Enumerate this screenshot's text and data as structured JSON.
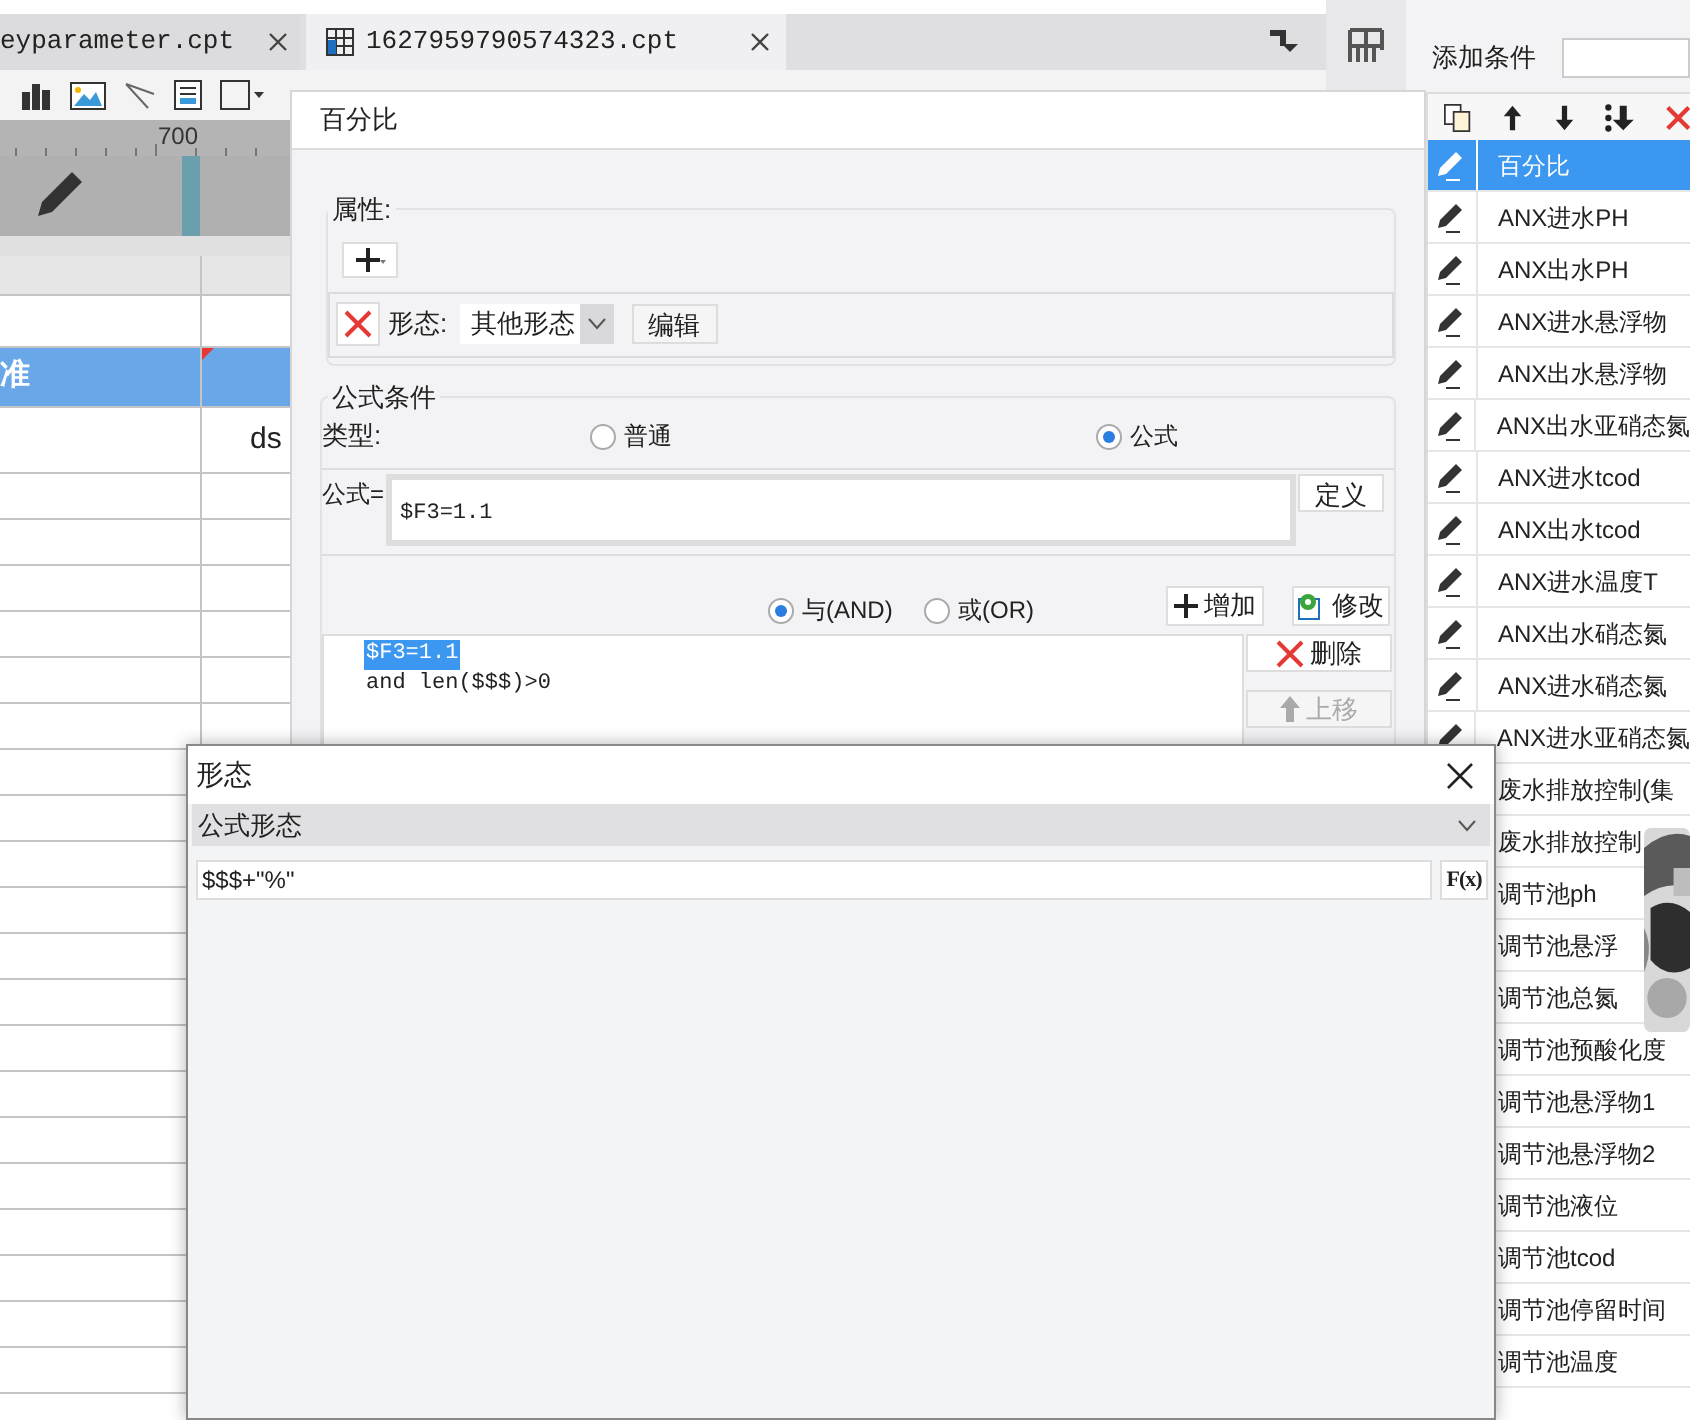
{
  "editor": {
    "tabs": [
      {
        "label": "eyparameter.cpt",
        "selected": false
      },
      {
        "label": "1627959790574323.cpt",
        "selected": true
      }
    ],
    "ruler_label": "700",
    "selected_row_text": "准",
    "cell_text": "ds"
  },
  "condition_dialog": {
    "title": "百分比",
    "attributes_legend": "属性:",
    "attribute": {
      "label": "形态:",
      "value": "其他形态",
      "edit_button": "编辑"
    },
    "formula_legend": "公式条件",
    "type_label": "类型:",
    "type_options": [
      {
        "label": "普通",
        "selected": false
      },
      {
        "label": "公式",
        "selected": true
      }
    ],
    "formula_label": "公式=",
    "formula": "$F3=1.1",
    "define_button": "定义",
    "joins": [
      {
        "label": "与(AND)",
        "selected": true
      },
      {
        "label": "或(OR)",
        "selected": false
      }
    ],
    "add_button": "增加",
    "modify_button": "修改",
    "conditions": [
      {
        "text": "$F3=1.1",
        "selected": true
      },
      {
        "text": "and len($$$)>0",
        "selected": false
      }
    ],
    "delete_button": "删除",
    "up_button": {
      "label": "上移",
      "disabled": true
    }
  },
  "conditions_panel": {
    "add_label": "添加条件",
    "items": [
      {
        "label": "百分比",
        "selected": true
      },
      {
        "label": "ANX进水PH",
        "selected": false
      },
      {
        "label": "ANX出水PH",
        "selected": false
      },
      {
        "label": "ANX进水悬浮物",
        "selected": false
      },
      {
        "label": "ANX出水悬浮物",
        "selected": false
      },
      {
        "label": "ANX出水亚硝态氮",
        "selected": false
      },
      {
        "label": "ANX进水tcod",
        "selected": false
      },
      {
        "label": "ANX出水tcod",
        "selected": false
      },
      {
        "label": "ANX进水温度T",
        "selected": false
      },
      {
        "label": "ANX出水硝态氮",
        "selected": false
      },
      {
        "label": "ANX进水硝态氮",
        "selected": false
      },
      {
        "label": "ANX进水亚硝态氮",
        "selected": false
      },
      {
        "label": "废水排放控制(集",
        "selected": false
      },
      {
        "label": "废水排放控制",
        "selected": false
      },
      {
        "label": "调节池ph",
        "selected": false
      },
      {
        "label": "调节池悬浮",
        "selected": false
      },
      {
        "label": "调节池总氮",
        "selected": false
      },
      {
        "label": "调节池预酸化度",
        "selected": false
      },
      {
        "label": "调节池悬浮物1",
        "selected": false
      },
      {
        "label": "调节池悬浮物2",
        "selected": false
      },
      {
        "label": "调节池液位",
        "selected": false
      },
      {
        "label": "调节池tcod",
        "selected": false
      },
      {
        "label": "调节池停留时间",
        "selected": false
      },
      {
        "label": "调节池温度",
        "selected": false
      }
    ]
  },
  "style_dialog": {
    "title": "形态",
    "type": "公式形态",
    "formula": "$$$+\"%\"",
    "fx_button": "F(x)"
  }
}
